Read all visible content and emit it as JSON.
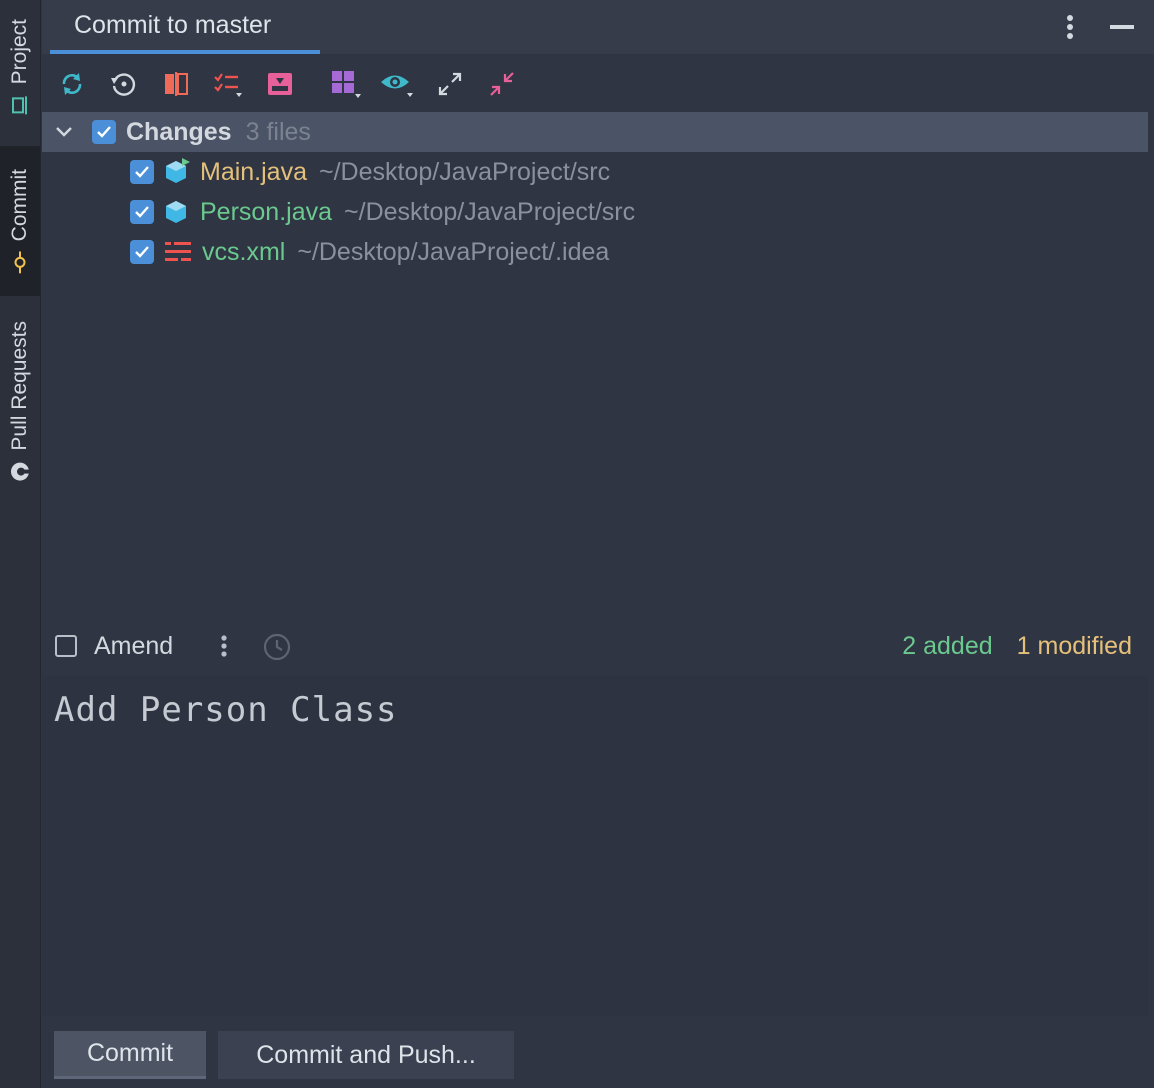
{
  "side_tabs": [
    {
      "label": "Project",
      "icon": "laptop-icon"
    },
    {
      "label": "Commit",
      "icon": "commit-icon"
    },
    {
      "label": "Pull Requests",
      "icon": "github-icon"
    }
  ],
  "header": {
    "title": "Commit to master"
  },
  "toolbar": {
    "icons": [
      "refresh-icon",
      "rollback-icon",
      "diff-icon",
      "changelist-icon",
      "shelve-icon",
      "group-by-icon",
      "view-options-icon",
      "expand-all-icon",
      "collapse-all-icon"
    ]
  },
  "changes": {
    "group_label": "Changes",
    "group_count": "3 files",
    "files": [
      {
        "name": "Main.java",
        "path": "~/Desktop/JavaProject/src",
        "color": "#e5c07b"
      },
      {
        "name": "Person.java",
        "path": "~/Desktop/JavaProject/src",
        "color": "#6bc98f"
      },
      {
        "name": "vcs.xml",
        "path": "~/Desktop/JavaProject/.idea",
        "color": "#6bc98f"
      }
    ]
  },
  "amend": {
    "label": "Amend"
  },
  "stats": {
    "added": "2 added",
    "modified": "1 modified"
  },
  "message": {
    "text": "Add Person Class"
  },
  "buttons": {
    "commit": "Commit",
    "commit_push": "Commit and Push..."
  },
  "colors": {
    "accent": "#4a8fd8",
    "added": "#6bc98f",
    "modified": "#e5c07b"
  }
}
